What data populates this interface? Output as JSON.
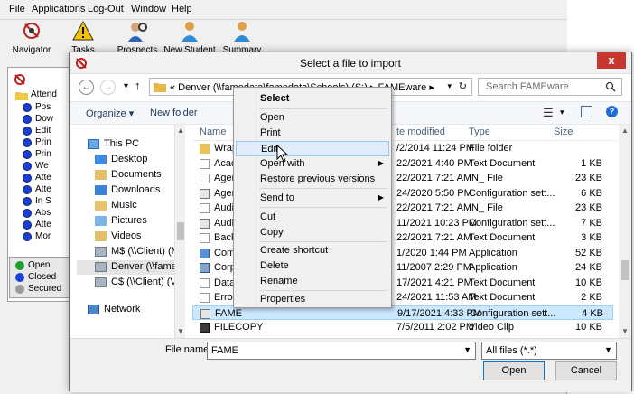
{
  "background_app": {
    "menu": [
      "File",
      "Applications",
      "Log-Out",
      "Window",
      "Help"
    ],
    "toolbar": [
      {
        "label": "Navigator",
        "icon": "navigator-icon"
      },
      {
        "label": "Tasks",
        "icon": "warning-icon"
      },
      {
        "label": "Prospects",
        "icon": "prospects-icon"
      },
      {
        "label": "New Student",
        "icon": "person-icon"
      },
      {
        "label": "Summary",
        "icon": "person-icon"
      }
    ],
    "tree": [
      "Attend",
      "Pos",
      "Dow",
      "Edit",
      "Prin",
      "Prin",
      "We",
      "Atte",
      "Atte",
      "In S",
      "Abs",
      "Atte",
      "Mor"
    ],
    "legend": [
      {
        "label": "Open",
        "color": "#1a9e2a"
      },
      {
        "label": "Closed",
        "color": "#1a3fd6"
      },
      {
        "label": "Secured",
        "color": "#9a9a9a"
      }
    ]
  },
  "dialog": {
    "title": "Select a file to import",
    "close": "x",
    "address": "«  Denver (\\\\famedata\\famedata\\Schools) (S:)  ▸ FAMEware  ▸",
    "search_placeholder": "Search FAMEware",
    "commands": {
      "organize": "Organize ▾",
      "new_folder": "New folder"
    },
    "nav": [
      {
        "label": "This PC",
        "icon": "pc-icon"
      },
      {
        "label": "Desktop",
        "icon": "folder-icon"
      },
      {
        "label": "Documents",
        "icon": "folder-icon"
      },
      {
        "label": "Downloads",
        "icon": "folder-icon"
      },
      {
        "label": "Music",
        "icon": "music-icon"
      },
      {
        "label": "Pictures",
        "icon": "folder-icon"
      },
      {
        "label": "Videos",
        "icon": "folder-icon"
      },
      {
        "label": "M$ (\\\\Client) (M:",
        "icon": "drive-icon"
      },
      {
        "label": "Denver (\\\\famed",
        "icon": "drive-icon"
      },
      {
        "label": "C$ (\\\\Client) (V:)",
        "icon": "drive-icon"
      },
      {
        "label": "Network",
        "icon": "network-icon"
      }
    ],
    "columns": {
      "name": "Name",
      "date": "te modified",
      "type": "Type",
      "size": "Size"
    },
    "files": [
      {
        "name": "Wrapp",
        "date": "/2/2014 11:24 PM",
        "type": "File folder",
        "size": ""
      },
      {
        "name": "Acade",
        "date": "22/2021 4:40 PM",
        "type": "Text Document",
        "size": "1 KB"
      },
      {
        "name": "Agen",
        "date": "22/2021 7:21 AM",
        "type": "IN_ File",
        "size": "23 KB"
      },
      {
        "name": "Agen",
        "date": "24/2020 5:50 PM",
        "type": "Configuration sett...",
        "size": "6 KB"
      },
      {
        "name": "Audit",
        "date": "22/2021 7:21 AM",
        "type": "IN_ File",
        "size": "23 KB"
      },
      {
        "name": "Audit",
        "date": "11/2021 10:23 PM",
        "type": "Configuration sett...",
        "size": "7 KB"
      },
      {
        "name": "Backu",
        "date": "22/2021 7:21 AM",
        "type": "Text Document",
        "size": "3 KB"
      },
      {
        "name": "Comp",
        "date": "1/2020 1:44 PM",
        "type": "Application",
        "size": "52 KB"
      },
      {
        "name": "Corpo",
        "date": "11/2007 2:29 PM",
        "type": "Application",
        "size": "24 KB"
      },
      {
        "name": "DataT",
        "date": "17/2021 4:21 PM",
        "type": "Text Document",
        "size": "10 KB"
      },
      {
        "name": "Error",
        "date": "24/2021 11:53 AM",
        "type": "Text Document",
        "size": "2 KB"
      },
      {
        "name": "FAME",
        "date": "9/17/2021 4:33 PM",
        "type": "Configuration sett...",
        "size": "4 KB"
      },
      {
        "name": "FILECOPY",
        "date": "7/5/2011 2:02 PM",
        "type": "Video Clip",
        "size": "10 KB"
      }
    ],
    "file_name_label": "File name:",
    "file_name_value": "FAME",
    "file_type_value": "All files (*.*)",
    "open_label": "Open",
    "cancel_label": "Cancel"
  },
  "context_menu": {
    "items": [
      "Select",
      "Open",
      "Print",
      "Edit",
      "Open with",
      "Restore previous versions",
      "Send to",
      "Cut",
      "Copy",
      "Create shortcut",
      "Delete",
      "Rename",
      "Properties"
    ],
    "highlighted": "Edit"
  }
}
